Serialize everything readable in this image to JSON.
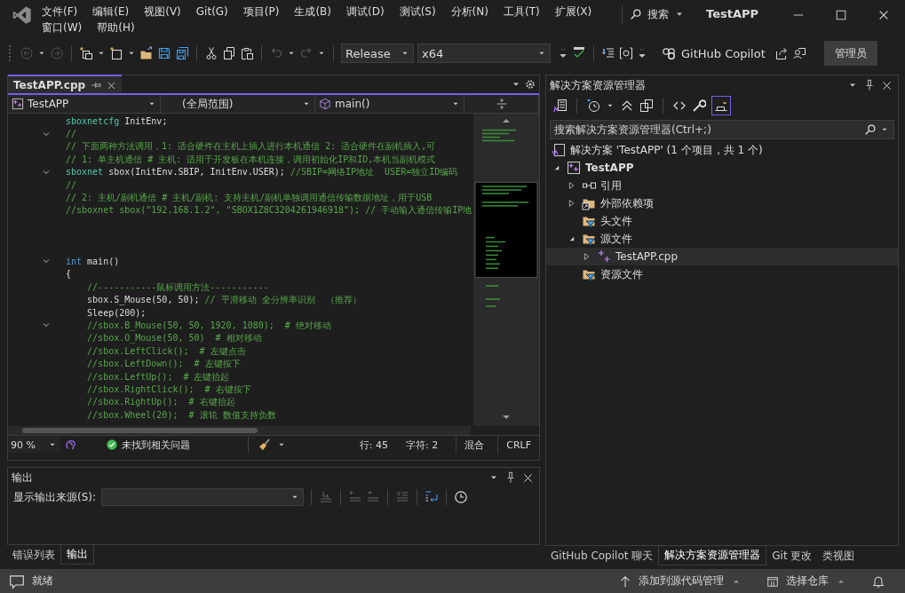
{
  "window": {
    "title": "TestAPP"
  },
  "menu": [
    "文件(F)",
    "编辑(E)",
    "视图(V)",
    "Git(G)",
    "项目(P)",
    "生成(B)",
    "调试(D)",
    "测试(S)",
    "分析(N)",
    "工具(T)",
    "扩展(X)",
    "窗口(W)",
    "帮助(H)"
  ],
  "search": {
    "label": "搜索"
  },
  "toolbar": {
    "configuration": "Release",
    "platform": "x64",
    "copilot": "GitHub Copilot",
    "admin": "管理员"
  },
  "editor": {
    "tab": {
      "label": "TestAPP.cpp",
      "selected": true
    },
    "project_dropdown": "TestAPP",
    "scope_dropdown": "(全局范围)",
    "member_dropdown": "main()",
    "lines": [
      {
        "foldable": false,
        "segments": [
          {
            "kind": "type",
            "text": "sboxnetcfg"
          },
          {
            "kind": "plain",
            "text": " InitEnv;"
          }
        ]
      },
      {
        "foldable": true,
        "segments": [
          {
            "kind": "comment",
            "text": "//"
          }
        ]
      },
      {
        "foldable": false,
        "segments": [
          {
            "kind": "comment",
            "text": "// 下面两种方法调用，1: 适合硬件在主机上插入进行本机通信 2: 适合硬件在副机插入,可"
          }
        ]
      },
      {
        "foldable": false,
        "segments": [
          {
            "kind": "comment",
            "text": "// 1: 单主机通信 # 主机: 适用于开发板在本机连接，调用初始化IP和ID,本机当副机模式"
          }
        ]
      },
      {
        "foldable": true,
        "segments": [
          {
            "kind": "type",
            "text": "sboxnet"
          },
          {
            "kind": "plain",
            "text": " sbox(InitEnv.SBIP, InitEnv.USER); "
          },
          {
            "kind": "comment",
            "text": "//SBIP=网络IP地址  USER=独立ID编码"
          }
        ]
      },
      {
        "foldable": false,
        "segments": [
          {
            "kind": "comment",
            "text": "//"
          }
        ]
      },
      {
        "foldable": false,
        "segments": [
          {
            "kind": "comment",
            "text": "// 2: 主机/副机通信 # 主机/副机: 支持主机/副机单独调用通信传输数据地址，用于USB"
          }
        ]
      },
      {
        "foldable": false,
        "segments": [
          {
            "kind": "comment",
            "text": "//sboxnet sbox(\"192.168.1.2\", \"SBOX1Z8C3204261946918\"); // 手动输入通信传输IP地"
          }
        ]
      },
      {
        "foldable": false
      },
      {
        "foldable": false
      },
      {
        "foldable": false
      },
      {
        "foldable": true,
        "segments": [
          {
            "kind": "keyword",
            "text": "int"
          },
          {
            "kind": "plain",
            "text": " main()"
          }
        ]
      },
      {
        "foldable": false,
        "segments": [
          {
            "kind": "plain",
            "text": "{"
          }
        ]
      },
      {
        "foldable": false,
        "segments": [
          {
            "kind": "comment",
            "text": "    //-----------鼠标调用方法-----------"
          }
        ]
      },
      {
        "foldable": false,
        "segments": [
          {
            "kind": "plain",
            "text": "    sbox.S_Mouse(50, 50); "
          },
          {
            "kind": "comment",
            "text": "// 平滑移动 全分辨率识别  （推荐）"
          }
        ]
      },
      {
        "foldable": false,
        "segments": [
          {
            "kind": "plain",
            "text": "    Sleep(200);"
          }
        ]
      },
      {
        "foldable": true,
        "segments": [
          {
            "kind": "comment",
            "text": "    //sbox.B_Mouse(50, 50, 1920, 1080);  # 绝对移动"
          }
        ]
      },
      {
        "foldable": false,
        "segments": [
          {
            "kind": "comment",
            "text": "    //sbox.O_Mouse(50, 50)  # 相对移动"
          }
        ]
      },
      {
        "foldable": false,
        "segments": [
          {
            "kind": "comment",
            "text": "    //sbox.LeftClick();  # 左键点击"
          }
        ]
      },
      {
        "foldable": false,
        "segments": [
          {
            "kind": "comment",
            "text": "    //sbox.LeftDown();  # 左键按下"
          }
        ]
      },
      {
        "foldable": false,
        "segments": [
          {
            "kind": "comment",
            "text": "    //sbox.LeftUp();  # 左键抬起"
          }
        ]
      },
      {
        "foldable": false,
        "segments": [
          {
            "kind": "comment",
            "text": "    //sbox.RightClick();  # 右键按下"
          }
        ]
      },
      {
        "foldable": false,
        "segments": [
          {
            "kind": "comment",
            "text": "    //sbox.RightUp();  # 右键抬起"
          }
        ]
      },
      {
        "foldable": false,
        "segments": [
          {
            "kind": "comment",
            "text": "    //sbox.Wheel(20);  # 滚轮 数值支持负数"
          }
        ]
      }
    ],
    "zoom": "90 %",
    "issues": "未找到相关问题",
    "line": "行: 45",
    "char": "字符: 2",
    "indent": "混合",
    "eol": "CRLF"
  },
  "output": {
    "title": "输出",
    "source_label": "显示输出来源(S):",
    "tabs": [
      {
        "label": "错误列表",
        "selected": false
      },
      {
        "label": "输出",
        "selected": true
      }
    ]
  },
  "solution_explorer": {
    "title": "解决方案资源管理器",
    "search": {
      "placeholder": "搜索解决方案资源管理器(Ctrl+;)"
    },
    "tree": [
      {
        "label": "解决方案 'TestAPP' (1 个项目，共 1 个)",
        "kind": "solution",
        "selected": false,
        "children": [
          {
            "label": "TestAPP",
            "kind": "project",
            "expanded": true,
            "selected": false,
            "children": [
              {
                "label": "引用",
                "kind": "references",
                "expanded": false,
                "selected": false
              },
              {
                "label": "外部依赖项",
                "kind": "external",
                "expanded": false,
                "selected": false
              },
              {
                "label": "头文件",
                "kind": "filter",
                "selected": false
              },
              {
                "label": "源文件",
                "kind": "filter",
                "expanded": true,
                "selected": false,
                "children": [
                  {
                    "label": "TestAPP.cpp",
                    "kind": "cpp",
                    "expanded": false,
                    "selected": true
                  }
                ]
              },
              {
                "label": "资源文件",
                "kind": "filter",
                "selected": false
              }
            ]
          }
        ]
      }
    ],
    "tabs": [
      {
        "label": "GitHub Copilot 聊天",
        "selected": false
      },
      {
        "label": "解决方案资源管理器",
        "selected": true
      },
      {
        "label": "Git 更改",
        "selected": false
      },
      {
        "label": "类视图",
        "selected": false
      }
    ]
  },
  "status_bar": {
    "ready": "就绪",
    "source_control": "添加到源代码管理",
    "repo": "选择仓库"
  }
}
